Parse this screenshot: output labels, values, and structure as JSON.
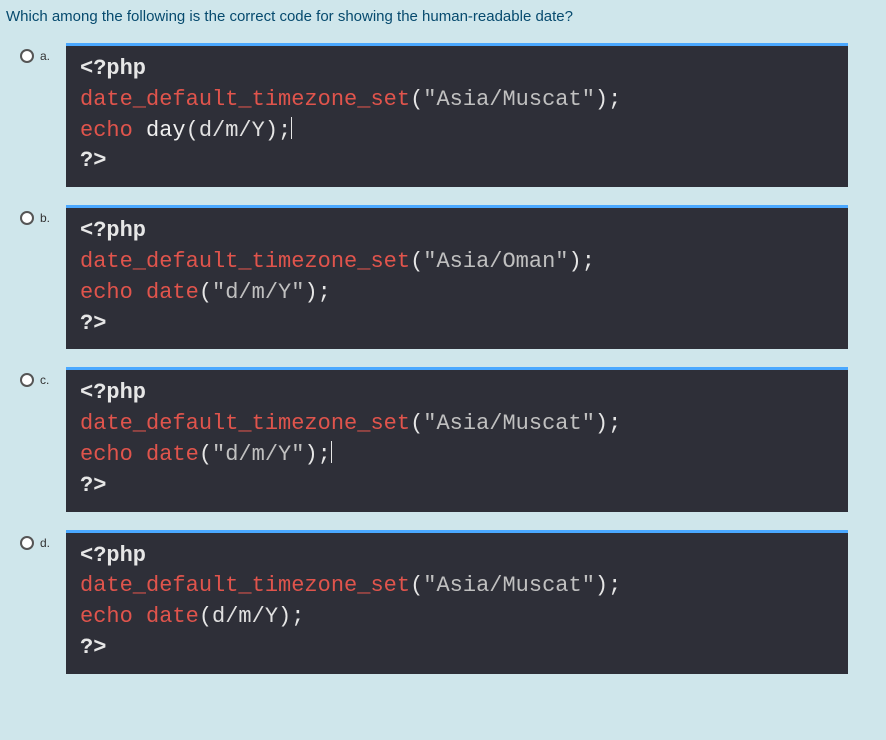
{
  "question": "Which among the following is the correct code for showing the human-readable date?",
  "options": [
    {
      "letter": "a.",
      "code": {
        "open": "<?php",
        "line2_fn": "date_default_timezone_set",
        "line2_paren_open": "(",
        "line2_arg": "\"Asia/Muscat\"",
        "line2_paren_close": ")",
        "line2_semi": ";",
        "line3_kw": "echo",
        "line3_space": " ",
        "line3_fn": "day",
        "line3_paren_open": "(",
        "line3_arg": "d/m/Y",
        "line3_paren_close": ")",
        "line3_semi": ";",
        "close": "?>",
        "has_cursor": true
      }
    },
    {
      "letter": "b.",
      "code": {
        "open": "<?php",
        "line2_fn": "date_default_timezone_set",
        "line2_paren_open": "(",
        "line2_arg": "\"Asia/Oman\"",
        "line2_paren_close": ")",
        "line2_semi": ";",
        "line3_kw": "echo",
        "line3_space": " ",
        "line3_fn": "date",
        "line3_paren_open": "(",
        "line3_arg": "\"d/m/Y\"",
        "line3_paren_close": ")",
        "line3_semi": ";",
        "close": "?>",
        "has_cursor": false,
        "arg_quoted": true
      }
    },
    {
      "letter": "c.",
      "code": {
        "open": "<?php",
        "line2_fn": "date_default_timezone_set",
        "line2_paren_open": "(",
        "line2_arg": "\"Asia/Muscat\"",
        "line2_paren_close": ")",
        "line2_semi": ";",
        "line3_kw": "echo",
        "line3_space": " ",
        "line3_fn": "date",
        "line3_paren_open": "(",
        "line3_arg": "\"d/m/Y\"",
        "line3_paren_close": ")",
        "line3_semi": ";",
        "close": "?>",
        "has_cursor": true,
        "arg_quoted": true
      }
    },
    {
      "letter": "d.",
      "code": {
        "open": "<?php",
        "line2_fn": "date_default_timezone_set",
        "line2_paren_open": "(",
        "line2_arg": "\"Asia/Muscat\"",
        "line2_paren_close": ")",
        "line2_semi": ";",
        "line3_kw": "echo",
        "line3_space": " ",
        "line3_fn": "date",
        "line3_paren_open": "(",
        "line3_arg": "d/m/Y",
        "line3_paren_close": ")",
        "line3_semi": ";",
        "close": "?>",
        "has_cursor": false
      }
    }
  ]
}
